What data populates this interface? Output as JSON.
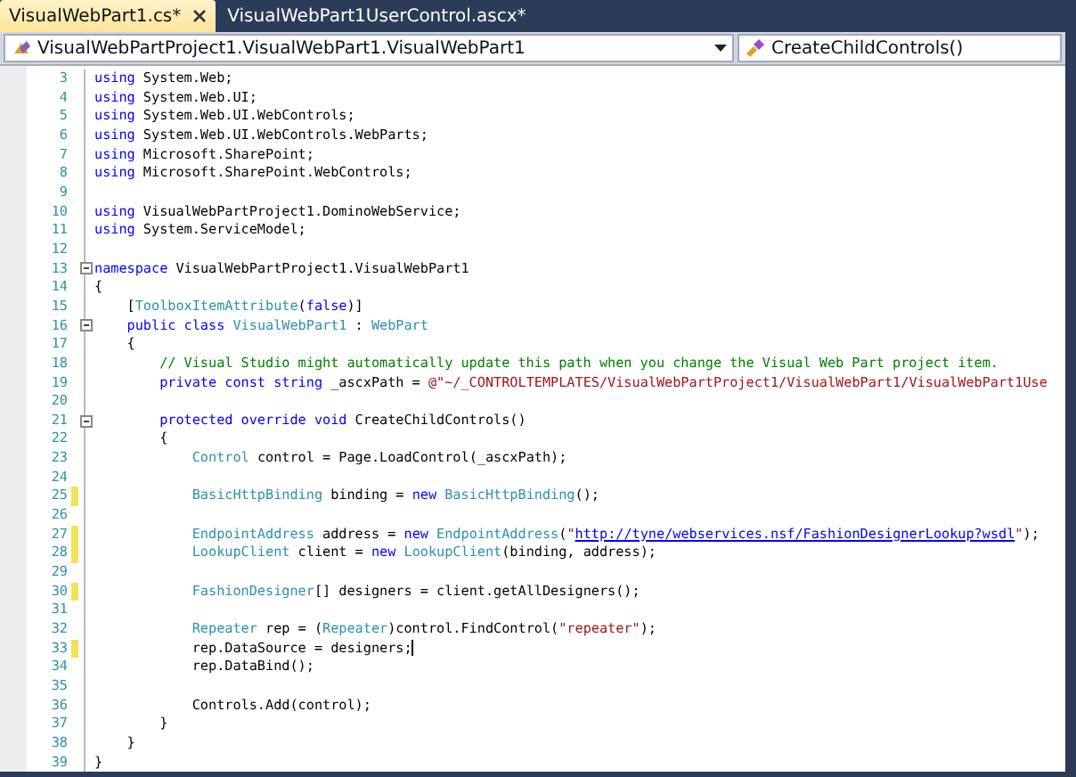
{
  "tabs": [
    {
      "label": "VisualWebPart1.cs*",
      "selected": true,
      "closable": true
    },
    {
      "label": "VisualWebPart1UserControl.ascx*",
      "selected": false,
      "closable": false
    }
  ],
  "navigation_bar": {
    "type_dropdown": "VisualWebPartProject1.VisualWebPart1.VisualWebPart1",
    "member_dropdown": "CreateChildControls()"
  },
  "lines": [
    {
      "number": "3",
      "changed": false,
      "collapsible": false,
      "tokens": [
        {
          "kind": "keyword",
          "text": "using"
        },
        {
          "kind": "plain",
          "text": " System.Web;"
        }
      ]
    },
    {
      "number": "4",
      "changed": false,
      "collapsible": false,
      "tokens": [
        {
          "kind": "keyword",
          "text": "using"
        },
        {
          "kind": "plain",
          "text": " System.Web.UI;"
        }
      ]
    },
    {
      "number": "5",
      "changed": false,
      "collapsible": false,
      "tokens": [
        {
          "kind": "keyword",
          "text": "using"
        },
        {
          "kind": "plain",
          "text": " System.Web.UI.WebControls;"
        }
      ]
    },
    {
      "number": "6",
      "changed": false,
      "collapsible": false,
      "tokens": [
        {
          "kind": "keyword",
          "text": "using"
        },
        {
          "kind": "plain",
          "text": " System.Web.UI.WebControls.WebParts;"
        }
      ]
    },
    {
      "number": "7",
      "changed": false,
      "collapsible": false,
      "tokens": [
        {
          "kind": "keyword",
          "text": "using"
        },
        {
          "kind": "plain",
          "text": " Microsoft.SharePoint;"
        }
      ]
    },
    {
      "number": "8",
      "changed": false,
      "collapsible": false,
      "tokens": [
        {
          "kind": "keyword",
          "text": "using"
        },
        {
          "kind": "plain",
          "text": " Microsoft.SharePoint.WebControls;"
        }
      ]
    },
    {
      "number": "9",
      "changed": false,
      "collapsible": false
    },
    {
      "number": "10",
      "changed": false,
      "collapsible": false,
      "tokens": [
        {
          "kind": "keyword",
          "text": "using"
        },
        {
          "kind": "plain",
          "text": " VisualWebPartProject1.DominoWebService;"
        }
      ]
    },
    {
      "number": "11",
      "changed": false,
      "collapsible": false,
      "tokens": [
        {
          "kind": "keyword",
          "text": "using"
        },
        {
          "kind": "plain",
          "text": " System.ServiceModel;"
        }
      ]
    },
    {
      "number": "12",
      "changed": false,
      "collapsible": false
    },
    {
      "number": "13",
      "changed": false,
      "collapsible": true,
      "tokens": [
        {
          "kind": "keyword",
          "text": "namespace"
        },
        {
          "kind": "plain",
          "text": " VisualWebPartProject1.VisualWebPart1"
        }
      ]
    },
    {
      "number": "14",
      "changed": false,
      "collapsible": false,
      "tokens": [
        {
          "kind": "plain",
          "text": "{"
        }
      ]
    },
    {
      "number": "15",
      "changed": false,
      "collapsible": false,
      "tokens": [
        {
          "kind": "plain",
          "text": "    ["
        },
        {
          "kind": "type",
          "text": "ToolboxItemAttribute"
        },
        {
          "kind": "plain",
          "text": "("
        },
        {
          "kind": "keyword",
          "text": "false"
        },
        {
          "kind": "plain",
          "text": ")]"
        }
      ]
    },
    {
      "number": "16",
      "changed": false,
      "collapsible": true,
      "tokens": [
        {
          "kind": "keyword",
          "text": "    public class"
        },
        {
          "kind": "type",
          "text": " VisualWebPart1"
        },
        {
          "kind": "plain",
          "text": " : "
        },
        {
          "kind": "type",
          "text": "WebPart"
        }
      ]
    },
    {
      "number": "17",
      "changed": false,
      "collapsible": false,
      "tokens": [
        {
          "kind": "plain",
          "text": "    {"
        }
      ]
    },
    {
      "number": "18",
      "changed": false,
      "collapsible": false,
      "tokens": [
        {
          "kind": "comment",
          "text": "        // Visual Studio might automatically update this path when you change the Visual Web Part project item."
        }
      ]
    },
    {
      "number": "19",
      "changed": false,
      "collapsible": false,
      "tokens": [
        {
          "kind": "keyword",
          "text": "        private const string"
        },
        {
          "kind": "plain",
          "text": " _ascxPath = "
        },
        {
          "kind": "string",
          "text": "@\"~/_CONTROLTEMPLATES/VisualWebPartProject1/VisualWebPart1/VisualWebPart1Use"
        }
      ]
    },
    {
      "number": "20",
      "changed": false,
      "collapsible": false
    },
    {
      "number": "21",
      "changed": false,
      "collapsible": true,
      "tokens": [
        {
          "kind": "keyword",
          "text": "        protected override void"
        },
        {
          "kind": "plain",
          "text": " CreateChildControls()"
        }
      ]
    },
    {
      "number": "22",
      "changed": false,
      "collapsible": false,
      "tokens": [
        {
          "kind": "plain",
          "text": "        {"
        }
      ]
    },
    {
      "number": "23",
      "changed": false,
      "collapsible": false,
      "tokens": [
        {
          "kind": "type",
          "text": "            Control"
        },
        {
          "kind": "plain",
          "text": " control = Page.LoadControl(_ascxPath);"
        }
      ]
    },
    {
      "number": "24",
      "changed": false,
      "collapsible": false
    },
    {
      "number": "25",
      "changed": true,
      "collapsible": false,
      "tokens": [
        {
          "kind": "type",
          "text": "            BasicHttpBinding"
        },
        {
          "kind": "plain",
          "text": " binding = "
        },
        {
          "kind": "keyword",
          "text": "new"
        },
        {
          "kind": "type",
          "text": " BasicHttpBinding"
        },
        {
          "kind": "plain",
          "text": "();"
        }
      ]
    },
    {
      "number": "26",
      "changed": false,
      "collapsible": false
    },
    {
      "number": "27",
      "changed": true,
      "collapsible": false,
      "tokens": [
        {
          "kind": "type",
          "text": "            EndpointAddress"
        },
        {
          "kind": "plain",
          "text": " address = "
        },
        {
          "kind": "keyword",
          "text": "new"
        },
        {
          "kind": "type",
          "text": " EndpointAddress"
        },
        {
          "kind": "plain",
          "text": "("
        },
        {
          "kind": "string",
          "text": "\""
        },
        {
          "kind": "link",
          "text": "http://tyne/webservices.nsf/FashionDesignerLookup?wsdl"
        },
        {
          "kind": "string",
          "text": "\""
        },
        {
          "kind": "plain",
          "text": ");"
        }
      ]
    },
    {
      "number": "28",
      "changed": true,
      "collapsible": false,
      "tokens": [
        {
          "kind": "type",
          "text": "            LookupClient"
        },
        {
          "kind": "plain",
          "text": " client = "
        },
        {
          "kind": "keyword",
          "text": "new"
        },
        {
          "kind": "type",
          "text": " LookupClient"
        },
        {
          "kind": "plain",
          "text": "(binding, address);"
        }
      ]
    },
    {
      "number": "29",
      "changed": false,
      "collapsible": false
    },
    {
      "number": "30",
      "changed": true,
      "collapsible": false,
      "tokens": [
        {
          "kind": "type",
          "text": "            FashionDesigner"
        },
        {
          "kind": "plain",
          "text": "[] designers = client.getAllDesigners();"
        }
      ]
    },
    {
      "number": "31",
      "changed": false,
      "collapsible": false
    },
    {
      "number": "32",
      "changed": false,
      "collapsible": false,
      "tokens": [
        {
          "kind": "type",
          "text": "            Repeater"
        },
        {
          "kind": "plain",
          "text": " rep = ("
        },
        {
          "kind": "type",
          "text": "Repeater"
        },
        {
          "kind": "plain",
          "text": ")control.FindControl("
        },
        {
          "kind": "string",
          "text": "\"repeater\""
        },
        {
          "kind": "plain",
          "text": ");"
        }
      ]
    },
    {
      "number": "33",
      "changed": true,
      "collapsible": false,
      "tokens": [
        {
          "kind": "plain",
          "text": "            rep.DataSource = designers;"
        },
        {
          "kind": "caret"
        }
      ]
    },
    {
      "number": "34",
      "changed": false,
      "collapsible": false,
      "tokens": [
        {
          "kind": "plain",
          "text": "            rep.DataBind();"
        }
      ]
    },
    {
      "number": "35",
      "changed": false,
      "collapsible": false
    },
    {
      "number": "36",
      "changed": false,
      "collapsible": false,
      "tokens": [
        {
          "kind": "plain",
          "text": "            Controls.Add(control);"
        }
      ]
    },
    {
      "number": "37",
      "changed": false,
      "collapsible": false,
      "tokens": [
        {
          "kind": "plain",
          "text": "        }"
        }
      ]
    },
    {
      "number": "38",
      "changed": false,
      "collapsible": false,
      "tokens": [
        {
          "kind": "plain",
          "text": "    }"
        }
      ]
    },
    {
      "number": "39",
      "changed": false,
      "collapsible": false,
      "tokens": [
        {
          "kind": "plain",
          "text": "}"
        }
      ]
    }
  ]
}
